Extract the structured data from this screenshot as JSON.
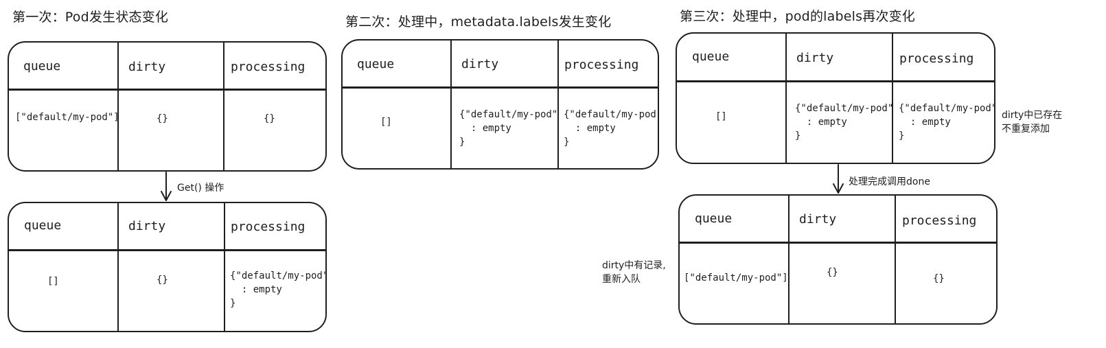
{
  "headings": {
    "first": "第一次：Pod发生状态变化",
    "second": "第二次：处理中，metadata.labels发生变化",
    "third": "第三次：处理中，pod的labels再次变化"
  },
  "column_headers": {
    "queue": "queue",
    "dirty": "dirty",
    "processing": "processing"
  },
  "tables": {
    "t1": {
      "queue": "[\"default/my-pod\"]",
      "dirty": "{}",
      "processing": "{}"
    },
    "t2": {
      "queue": "[]",
      "dirty": "{}",
      "processing": "{\"default/my-pod\"\n  : empty\n}"
    },
    "t3": {
      "queue": "[]",
      "dirty": "{\"default/my-pod\"\n  : empty\n}",
      "processing": "{\"default/my-pod\"\n  : empty\n}"
    },
    "t4": {
      "queue": "[]",
      "dirty": "{\"default/my-pod\"\n  : empty\n}",
      "processing": "{\"default/my-pod\"\n  : empty\n}"
    },
    "t5": {
      "queue": "[\"default/my-pod\"]",
      "dirty": "{}",
      "processing": "{}"
    }
  },
  "arrows": {
    "get": "Get() 操作",
    "done": "处理完成调用done"
  },
  "notes": {
    "dirty_exists_line1": "dirty中已存在",
    "dirty_exists_line2": "不重复添加",
    "requeue_line1": "dirty中有记录,",
    "requeue_line2": "重新入队"
  },
  "colors": {
    "stroke": "#1e1e1e",
    "background": "#ffffff"
  }
}
